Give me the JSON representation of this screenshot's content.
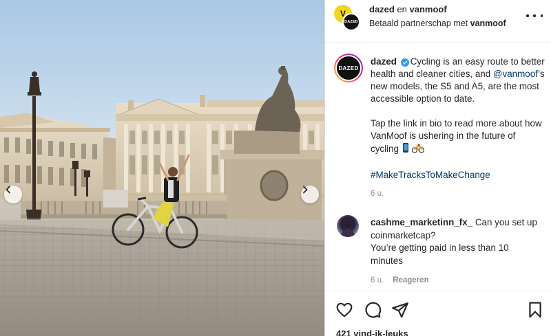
{
  "header": {
    "account": "dazed",
    "connector": " en ",
    "partner": "vanmoof",
    "subtitle_prefix": "Betaald partnerschap met ",
    "subtitle_partner": "vanmoof",
    "logo_back_text": "V",
    "logo_front_text": "DAZED"
  },
  "caption": {
    "avatar_text": "DAZED",
    "username": "dazed",
    "line1": "Cycling is an easy route to better health and cleaner cities, and ",
    "mention": "@vanmoof",
    "line1_rest": "’s new models, the S5 and A5, are the most accessible option to date.",
    "para2": "Tap the link in bio to read more about how VanMoof is ushering in the future of cycling",
    "hashtag": "#MakeTracksToMakeChange",
    "time": "6 u."
  },
  "comment": {
    "username": "cashme_marketinn_fx_",
    "text": "Can you set up coinmarketcap?",
    "text2": "You’re getting paid in less than 10 minutes",
    "time": "6 u.",
    "reply": "Reageren"
  },
  "actions": {
    "likes": "421 vind-ik-leuks"
  },
  "colors": {
    "link": "#00376b",
    "muted": "#8e8e8e",
    "verified": "#3897f0",
    "text": "#262626"
  },
  "icons": [
    "chevron-left-icon",
    "chevron-right-icon",
    "more-icon",
    "verified-icon",
    "phone-emoji-icon",
    "bicycle-emoji-icon",
    "heart-icon",
    "comment-icon",
    "share-icon",
    "bookmark-icon"
  ]
}
